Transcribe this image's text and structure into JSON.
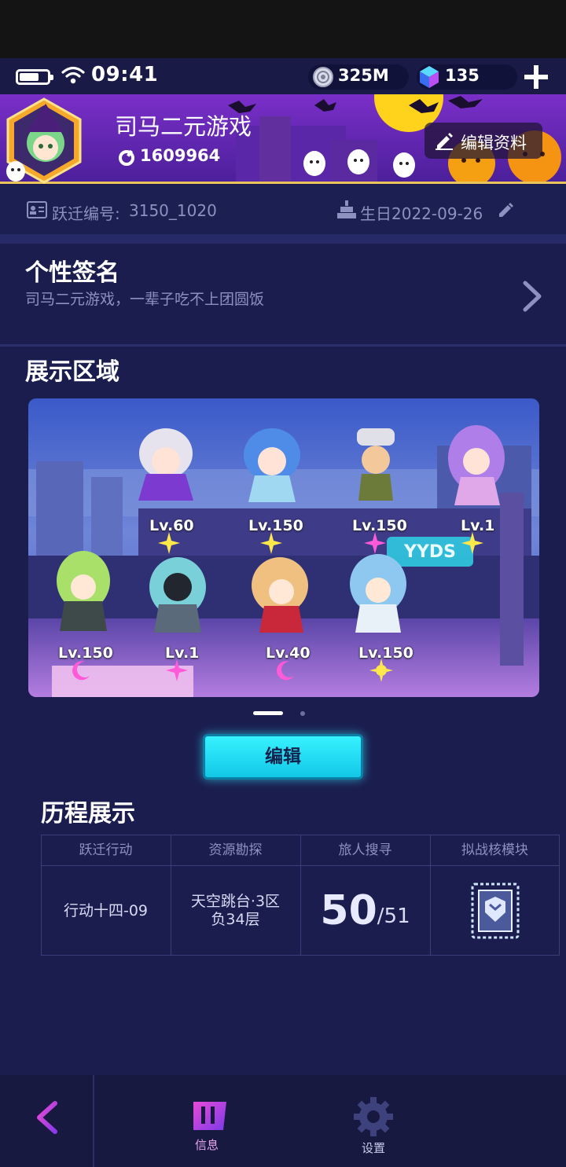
{
  "status_bar": {
    "time": "09:41",
    "coins": "325M",
    "gems": "135"
  },
  "profile": {
    "name": "司马二元游戏",
    "id": "1609964",
    "edit_profile_label": "编辑资料"
  },
  "info": {
    "id_label": "跃迁编号:",
    "id_value": "3150_1020",
    "birthday": "生日2022-09-26"
  },
  "signature": {
    "title": "个性签名",
    "text": "司马二元游戏，一辈子吃不上团圆饭"
  },
  "showcase": {
    "title": "展示区域",
    "characters": [
      {
        "level": "Lv.60",
        "badge": "star-badge-icon"
      },
      {
        "level": "Lv.150",
        "badge": "star-badge-icon"
      },
      {
        "level": "Lv.150",
        "badge": "pink-star-badge-icon"
      },
      {
        "level": "Lv.1",
        "badge": "star-badge-icon"
      },
      {
        "level": "Lv.150",
        "badge": "moon-badge-icon"
      },
      {
        "level": "Lv.1",
        "badge": "pink-star-badge-icon"
      },
      {
        "level": "Lv.40",
        "badge": "moon-badge-icon"
      },
      {
        "level": "Lv.150",
        "badge": "sun-badge-icon"
      }
    ],
    "sign_text": "YYDS",
    "page_index": 1,
    "page_count": 2
  },
  "edit_button_label": "编辑",
  "history": {
    "title": "历程展示",
    "headers": [
      "跃迁行动",
      "资源勘探",
      "旅人搜寻",
      "拟战核模块"
    ],
    "action": "行动十四-09",
    "resource_line1": "天空跳台·3区",
    "resource_line2": "负34层",
    "travelers_found": "50",
    "travelers_total": "/51"
  },
  "nav": {
    "info_label": "信息",
    "settings_label": "设置"
  },
  "colors": {
    "background": "#1b1d4f",
    "accent_cyan": "#37f2ff",
    "accent_purple": "#b43de0",
    "muted_text": "#8c91c0"
  }
}
